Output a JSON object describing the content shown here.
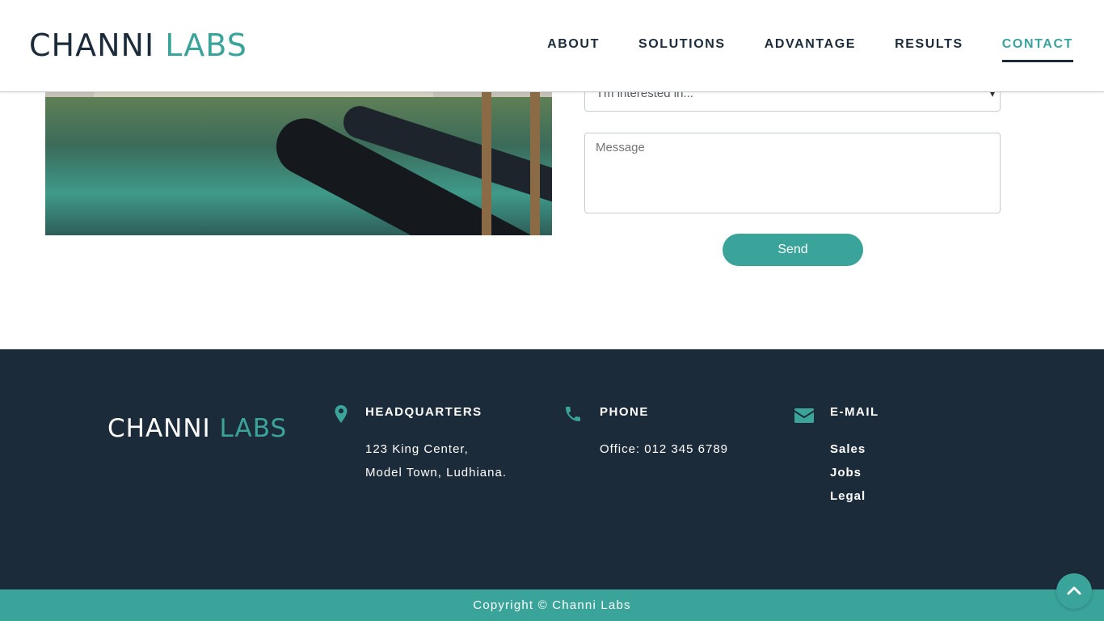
{
  "header": {
    "logo_part1": "CHANNI",
    "logo_part2": "LABS",
    "nav": [
      {
        "label": "ABOUT"
      },
      {
        "label": "SOLUTIONS"
      },
      {
        "label": "ADVANTAGE"
      },
      {
        "label": "RESULTS"
      },
      {
        "label": "CONTACT",
        "active": true
      }
    ]
  },
  "form": {
    "interest_select": "I'm interested in...",
    "message_placeholder": "Message",
    "send_label": "Send"
  },
  "footer": {
    "logo_part1": "CHANNI",
    "logo_part2": "LABS",
    "headquarters": {
      "title": "HEADQUARTERS",
      "line1": "123 King Center,",
      "line2": "Model Town, Ludhiana."
    },
    "phone": {
      "title": "PHONE",
      "line1": "Office: 012 345 6789"
    },
    "email": {
      "title": "E-MAIL",
      "links": [
        "Sales",
        "Jobs",
        "Legal"
      ]
    },
    "copyright": "Copyright © Channi Labs"
  },
  "colors": {
    "accent": "#3aa39a",
    "dark": "#1c2b3a"
  },
  "icons": {
    "headquarters": "map-pin-icon",
    "phone": "phone-icon",
    "email": "envelope-icon",
    "back_to_top": "chevron-up-icon"
  }
}
